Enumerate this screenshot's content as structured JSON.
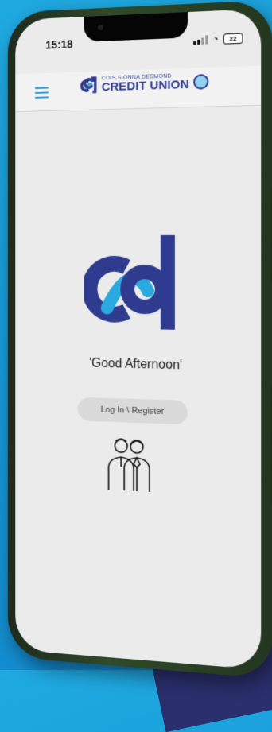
{
  "status_bar": {
    "time": "15:18",
    "battery": "22"
  },
  "header": {
    "brand_top": "COIS SIONNA DESMOND",
    "brand_main": "CREDIT UNION",
    "menu_icon": "hamburger-icon"
  },
  "main": {
    "greeting": "'Good Afternoon'",
    "login_label": "Log In \\ Register",
    "illustration_icon": "people-icon"
  },
  "colors": {
    "brand_navy": "#2f3b8f",
    "brand_cyan": "#2aa8e0",
    "background_blue": "#1596d6",
    "screen_bg": "#ebebeb"
  }
}
